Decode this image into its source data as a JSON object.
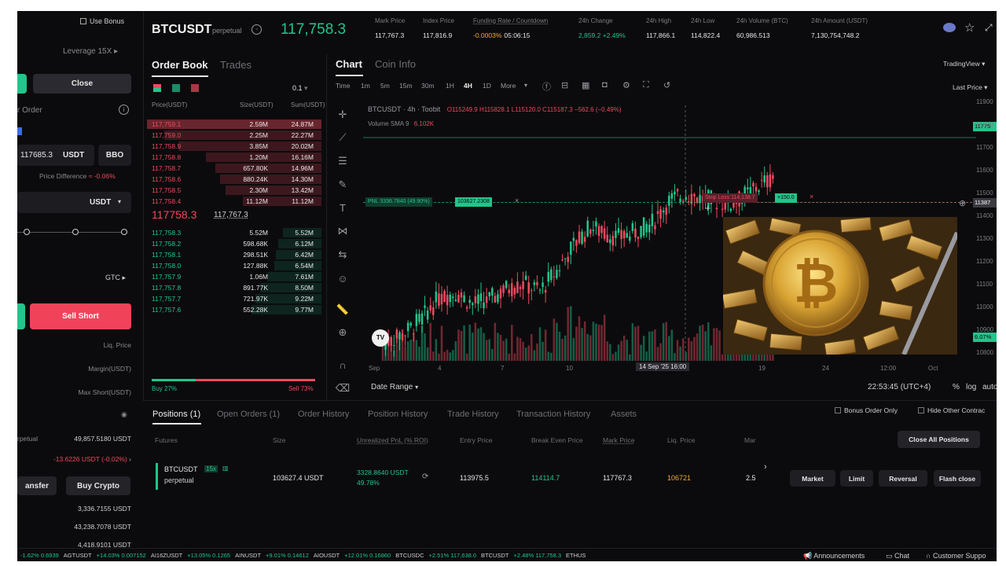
{
  "left_panel": {
    "use_bonus": "Use Bonus",
    "leverage": "Leverage 15X",
    "close_tab": "Close",
    "order_label": "r Order",
    "price_value": "117685.3",
    "price_unit": "USDT",
    "bbo": "BBO",
    "price_diff_label": "Price Difference",
    "price_diff_value": "≈ -0.06%",
    "amount_unit": "USDT",
    "tif": "GTC",
    "sell_short": "Sell Short",
    "liq_price": "Liq. Price",
    "margin": "Margin(USDT)",
    "max_short": "Max Short(USDT)",
    "account": {
      "label": "rpetual",
      "equity": "49,857.5180 USDT",
      "pnl": "-13.6226 USDT (-0.02%)",
      "transfer": "ansfer",
      "buy_crypto": "Buy Crypto",
      "v1": "3,336.7155 USDT",
      "v2": "43,238.7078 USDT",
      "v3": "4,418.9101 USDT"
    }
  },
  "header": {
    "symbol": "BTCUSDT",
    "type": "perpetual",
    "price": "117,758.3",
    "stats": [
      {
        "label": "Mark Price",
        "value": "117,767.3"
      },
      {
        "label": "Index Price",
        "value": "117,816.9"
      },
      {
        "label": "Funding Rate / Countdown",
        "value": "-0.0003%",
        "value2": "05:06:15"
      },
      {
        "label": "24h Change",
        "value": "2,859.2 +2.49%"
      },
      {
        "label": "24h High",
        "value": "117,866.1"
      },
      {
        "label": "24h Low",
        "value": "114,822.4"
      },
      {
        "label": "24h Volume (BTC)",
        "value": "60,986.513"
      },
      {
        "label": "24h Amount (USDT)",
        "value": "7,130,754,748.2"
      }
    ]
  },
  "orderbook": {
    "tab_book": "Order Book",
    "tab_trades": "Trades",
    "precision": "0.1",
    "headers": [
      "Price(USDT)",
      "Size(USDT)",
      "Sum(USDT)"
    ],
    "asks": [
      {
        "price": "117,759.1",
        "size": "2.59M",
        "sum": "24.87M",
        "depth": 1.0
      },
      {
        "price": "117,759.0",
        "size": "2.25M",
        "sum": "22.27M",
        "depth": 0.9
      },
      {
        "price": "117,758.9",
        "size": "3.85M",
        "sum": "20.02M",
        "depth": 0.82
      },
      {
        "price": "117,758.8",
        "size": "1.20M",
        "sum": "16.16M",
        "depth": 0.66
      },
      {
        "price": "117,758.7",
        "size": "657.80K",
        "sum": "14.96M",
        "depth": 0.61
      },
      {
        "price": "117,758.6",
        "size": "880.24K",
        "sum": "14.30M",
        "depth": 0.58
      },
      {
        "price": "117,758.5",
        "size": "2.30M",
        "sum": "13.42M",
        "depth": 0.55
      },
      {
        "price": "117,758.4",
        "size": "11.12M",
        "sum": "11.12M",
        "depth": 0.45
      }
    ],
    "last_price": "117758.3",
    "mark_price": "117,767.3",
    "bids": [
      {
        "price": "117,758.3",
        "size": "5.52M",
        "sum": "5.52M",
        "depth": 0.22
      },
      {
        "price": "117,758.2",
        "size": "598.68K",
        "sum": "6.12M",
        "depth": 0.25
      },
      {
        "price": "117,758.1",
        "size": "298.51K",
        "sum": "6.42M",
        "depth": 0.26
      },
      {
        "price": "117,758.0",
        "size": "127.88K",
        "sum": "6.54M",
        "depth": 0.27
      },
      {
        "price": "117,757.9",
        "size": "1.06M",
        "sum": "7.61M",
        "depth": 0.31
      },
      {
        "price": "117,757.8",
        "size": "891.77K",
        "sum": "8.50M",
        "depth": 0.35
      },
      {
        "price": "117,757.7",
        "size": "721.97K",
        "sum": "9.22M",
        "depth": 0.38
      },
      {
        "price": "117,757.6",
        "size": "552.28K",
        "sum": "9.77M",
        "depth": 0.4
      }
    ],
    "buy_pct": "Buy 27%",
    "sell_pct": "Sell 73%",
    "buy_ratio": 0.27
  },
  "chart": {
    "tab_chart": "Chart",
    "tab_info": "Coin Info",
    "tradingview": "TradingView",
    "last_price_sel": "Last Price",
    "intervals": [
      "Time",
      "1m",
      "5m",
      "15m",
      "30m",
      "1H",
      "4H",
      "1D",
      "More"
    ],
    "legend_title": "BTCUSDT · 4h · Toobit",
    "legend_ohlc": "O115249.9 H115828.1 L115120.0 C115187.3 −562.6 (−0.49%)",
    "volume_label": "Volume SMA 9",
    "volume_value": "6.102K",
    "pnl_tag": "PNL 3336.7840 (49.90%)",
    "pos_tag": "103627.2308",
    "stop_loss": "Stop Loss 114,138.7",
    "sl_qty": "+150.0",
    "price_tag": "11775",
    "cross_tag": "11387",
    "pct_tag": "6.07%",
    "y_ticks": [
      "11900",
      "11800",
      "11700",
      "11600",
      "11500",
      "11400",
      "11300",
      "11200",
      "11100",
      "11000",
      "10900",
      "10800"
    ],
    "x_ticks": [
      "Sep",
      "4",
      "7",
      "10",
      "14 Sep '25   16:00",
      "19",
      "24",
      "12:00",
      "Oct"
    ],
    "date_range": "Date Range",
    "clock": "22:53:45 (UTC+4)",
    "pct": "%",
    "log": "log",
    "auto": "auto",
    "tv_logo": "TV"
  },
  "bottom": {
    "tabs": [
      "Positions (1)",
      "Open Orders (1)",
      "Order History",
      "Position History",
      "Trade History",
      "Transaction History",
      "Assets"
    ],
    "bonus_only": "Bonus Order Only",
    "hide_other": "Hide Other Contrac",
    "close_all": "Close All Positions",
    "columns": [
      "Futures",
      "Size",
      "Unrealized PnL (% ROI)",
      "Entry Price",
      "Break Even Price",
      "Mark Price",
      "Liq. Price",
      "Mar"
    ],
    "position": {
      "symbol": "BTCUSDT",
      "lev": "15x",
      "type": "perpetual",
      "size": "103627.4 USDT",
      "pnl": "3328.8640 USDT",
      "roi": "49.78%",
      "entry": "113975.5",
      "break_even": "114114.7",
      "mark": "117767.3",
      "liq": "106721",
      "margin": "2.5"
    },
    "actions": [
      "Market",
      "Limit",
      "Reversal",
      "Flash close"
    ]
  },
  "ticker": [
    {
      "text": "-1.62%  0.6939",
      "color": "#22c58b"
    },
    {
      "text": "AGTUSDT",
      "color": "#cfcfcf"
    },
    {
      "text": "+14.03%  0.007152",
      "color": "#22c58b"
    },
    {
      "text": "AI16ZUSDT",
      "color": "#cfcfcf"
    },
    {
      "text": "+13.05%  0.1265",
      "color": "#22c58b"
    },
    {
      "text": "AINUSDT",
      "color": "#cfcfcf"
    },
    {
      "text": "+9.01%  0.14612",
      "color": "#22c58b"
    },
    {
      "text": "AIOUSDT",
      "color": "#cfcfcf"
    },
    {
      "text": "+12.01%  0.16860",
      "color": "#22c58b"
    },
    {
      "text": "BTCUSDC",
      "color": "#cfcfcf"
    },
    {
      "text": "+2.51%  117,638.0",
      "color": "#22c58b"
    },
    {
      "text": "BTCUSDT",
      "color": "#cfcfcf"
    },
    {
      "text": "+2.48%  117,758.3",
      "color": "#22c58b"
    },
    {
      "text": "ETHUS",
      "color": "#cfcfcf"
    }
  ],
  "footer": {
    "announcements": "Announcements",
    "chat": "Chat",
    "support": "Customer Suppo"
  },
  "colors": {
    "up": "#22c58b",
    "down": "#ef4a5d",
    "sell_btn": "#f0435a",
    "orange": "#f3a93a"
  }
}
